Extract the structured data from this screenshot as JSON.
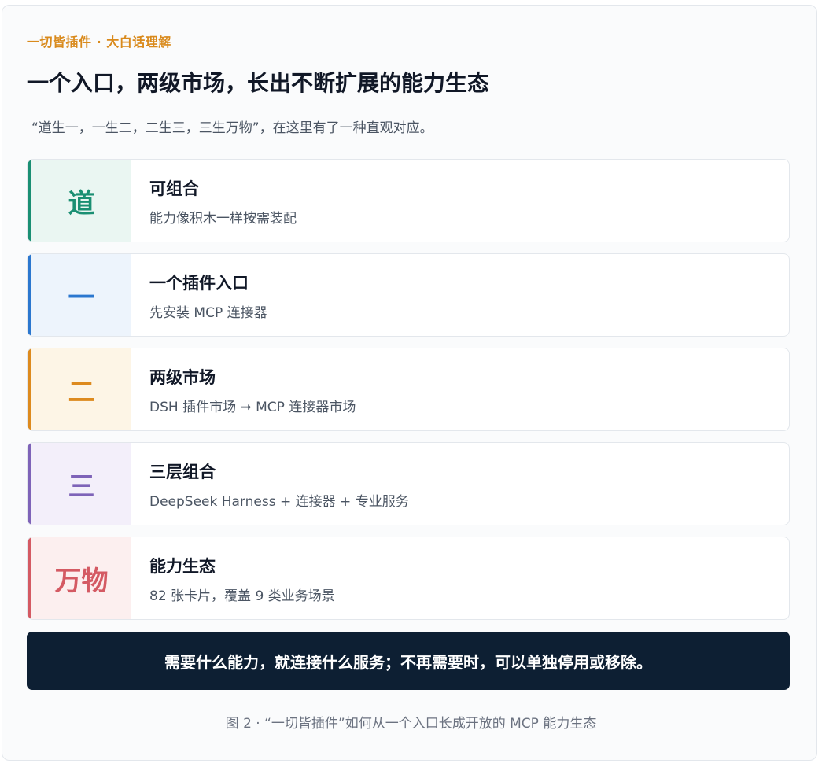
{
  "header": {
    "eyebrow": "一切皆插件 · 大白话理解",
    "title": "一个入口，两级市场，长出不断扩展的能力生态",
    "subtitle": "“道生一，一生二，二生三，三生万物”，在这里有了一种直观对应。"
  },
  "cards": [
    {
      "badge": "道",
      "title": "可组合",
      "desc": "能力像积木一样按需装配",
      "accent_color": "#1a8f73",
      "badge_bg": "#eaf6f2"
    },
    {
      "badge": "一",
      "title": "一个插件入口",
      "desc": "先安装 MCP 连接器",
      "accent_color": "#2b77cf",
      "badge_bg": "#edf4fc"
    },
    {
      "badge": "二",
      "title": "两级市场",
      "desc": "DSH 插件市场 ➞ MCP 连接器市场",
      "accent_color": "#dd8a1e",
      "badge_bg": "#fdf5e6"
    },
    {
      "badge": "三",
      "title": "三层组合",
      "desc": "DeepSeek Harness + 连接器 + 专业服务",
      "accent_color": "#7e63b8",
      "badge_bg": "#f3effa"
    },
    {
      "badge": "万物",
      "title": "能力生态",
      "desc": "82 张卡片，覆盖 9 类业务场景",
      "accent_color": "#d45a63",
      "badge_bg": "#fcefef"
    }
  ],
  "banner": {
    "text": "需要什么能力，就连接什么服务；不再需要时，可以单独停用或移除。"
  },
  "caption": "图 2 · “一切皆插件”如何从一个入口长成开放的 MCP 能力生态"
}
